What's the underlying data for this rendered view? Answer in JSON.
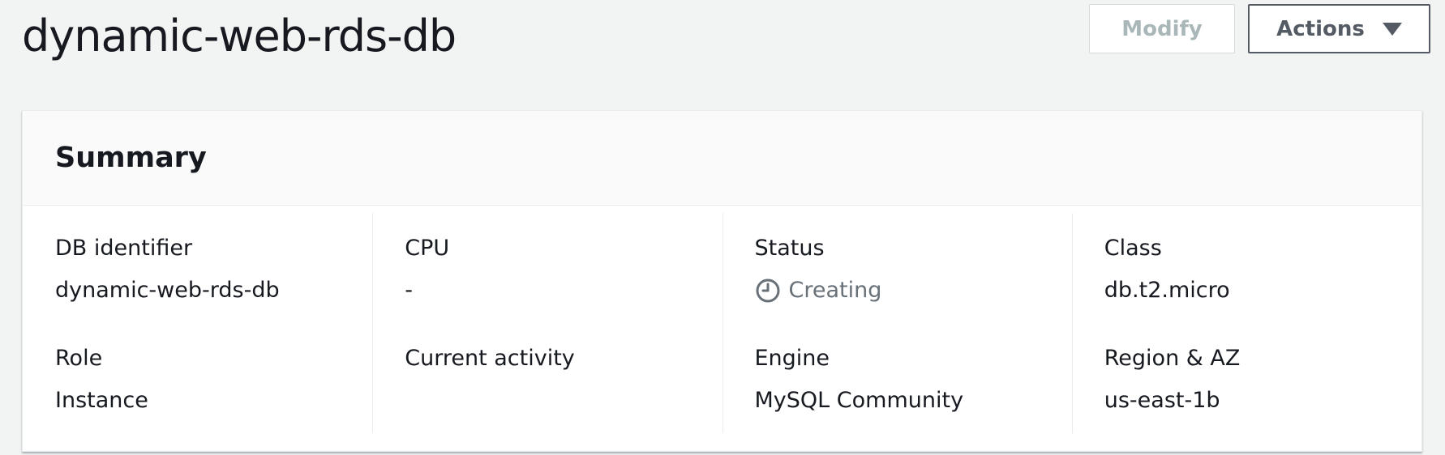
{
  "header": {
    "title": "dynamic-web-rds-db",
    "modify_label": "Modify",
    "actions_label": "Actions"
  },
  "summary": {
    "heading": "Summary",
    "columns": [
      {
        "row1": {
          "label": "DB identifier",
          "value": "dynamic-web-rds-db"
        },
        "row2": {
          "label": "Role",
          "value": "Instance"
        }
      },
      {
        "row1": {
          "label": "CPU",
          "value": "-"
        },
        "row2": {
          "label": "Current activity",
          "value": ""
        }
      },
      {
        "row1": {
          "label": "Status",
          "value": "Creating",
          "icon": "clock-icon"
        },
        "row2": {
          "label": "Engine",
          "value": "MySQL Community"
        }
      },
      {
        "row1": {
          "label": "Class",
          "value": "db.t2.micro"
        },
        "row2": {
          "label": "Region & AZ",
          "value": "us-east-1b"
        }
      }
    ]
  },
  "colors": {
    "background": "#f2f3f3",
    "text": "#16191f",
    "muted_text": "#687078",
    "disabled_text": "#aab7b8",
    "button_border": "#545b64"
  }
}
